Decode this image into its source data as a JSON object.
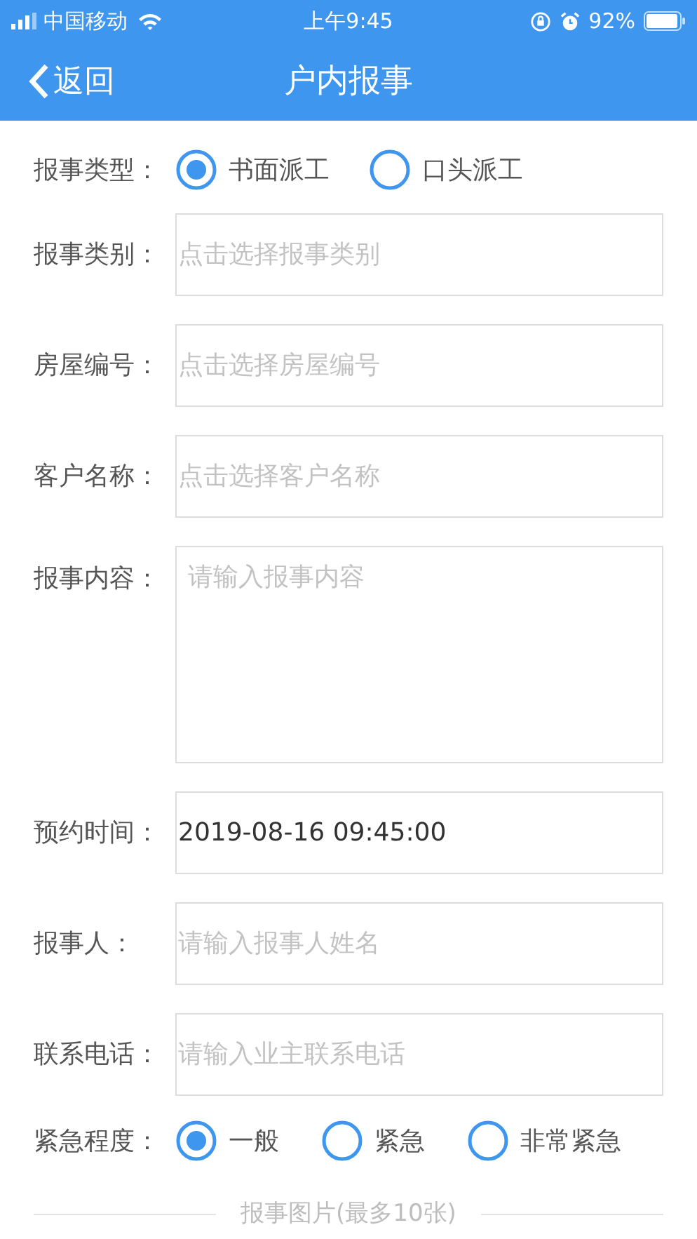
{
  "status_bar": {
    "carrier": "中国移动",
    "time": "上午9:45",
    "battery": "92%"
  },
  "nav": {
    "back": "返回",
    "title": "户内报事"
  },
  "report_type": {
    "label": "报事类型：",
    "options": [
      {
        "label": "书面派工",
        "selected": true
      },
      {
        "label": "口头派工",
        "selected": false
      }
    ]
  },
  "fields": [
    {
      "kind": "select",
      "label": "报事类别：",
      "placeholder": "点击选择报事类别"
    },
    {
      "kind": "select",
      "label": "房屋编号：",
      "placeholder": "点击选择房屋编号"
    },
    {
      "kind": "select",
      "label": "客户名称：",
      "placeholder": "点击选择客户名称"
    },
    {
      "kind": "textarea",
      "label": "报事内容：",
      "placeholder": "请输入报事内容"
    },
    {
      "kind": "input",
      "label": "预约时间：",
      "value": "2019-08-16 09:45:00"
    },
    {
      "kind": "input",
      "label": "报事人：",
      "placeholder": "请输入报事人姓名"
    },
    {
      "kind": "input",
      "label": "联系电话：",
      "placeholder": "请输入业主联系电话"
    }
  ],
  "urgency": {
    "label": "紧急程度：",
    "options": [
      {
        "label": "一般",
        "selected": true
      },
      {
        "label": "紧急",
        "selected": false
      },
      {
        "label": "非常紧急",
        "selected": false
      }
    ]
  },
  "photos_caption": "报事图片(最多10张)"
}
